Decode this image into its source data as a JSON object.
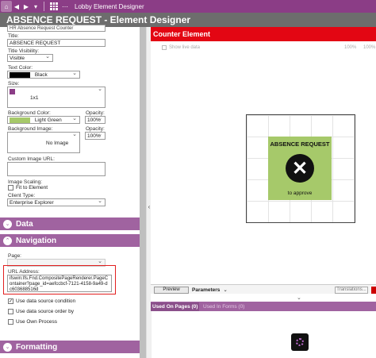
{
  "titlebar": {
    "title": "Lobby Element Designer"
  },
  "header": {
    "title": "ABSENCE REQUEST - Element Designer"
  },
  "form": {
    "top_cut_text": "HR Absence Request Counter",
    "title_label": "Title:",
    "title_value": "ABSENCE REQUEST",
    "title_visibility_label": "Title Visibility:",
    "title_visibility_value": "Visible",
    "text_color_label": "Text Color:",
    "text_color_value": "Black",
    "size_label": "Size:",
    "size_value": "1x1",
    "bg_color_label": "Background Color:",
    "bg_color_value": "Light Green",
    "opacity_label": "Opacity:",
    "opacity_value": "100%",
    "bg_image_label": "Background Image:",
    "bg_image_value": "No Image",
    "opacity2_label": "Opacity:",
    "opacity2_value": "100%",
    "custom_image_label": "Custom Image URL:",
    "custom_image_value": "",
    "image_scaling_label": "Image Scaling:",
    "fit_to_element_label": "Fit to Element",
    "client_type_label": "Client Type:",
    "client_type_value": "Enterprise Explorer"
  },
  "sections": {
    "data": "Data",
    "navigation": "Navigation",
    "formatting": "Formatting"
  },
  "navigation": {
    "page_label": "Page:",
    "page_value": "",
    "url_label": "URL Address:",
    "url_value": "ifswin:Ifs.Fnd.CompositePageRenderer.PageContainer?page_id=aefccbcf-7121-4158-9a49-dc603688516d",
    "use_ds_condition": "Use data source condition",
    "use_ds_order": "Use data source order by",
    "use_own_process": "Use Own Process"
  },
  "preview": {
    "header": "Counter Element",
    "show_live_data": "Show live data",
    "zoom_a": "100%",
    "zoom_b": "100%",
    "element_title": "ABSENCE REQUEST",
    "element_subtitle": "to approve",
    "element_icon": "x-circle-icon",
    "element_bg": "#a6c96a"
  },
  "bottom": {
    "preview_tab": "Preview",
    "parameters_tab": "Parameters",
    "translations_btn": "Translations...",
    "used_on_pages": "Used On Pages (0)",
    "used_in_forms": "Used In Forms (0)"
  },
  "colors": {
    "titlebar": "#8b3d86",
    "section": "#a063a0",
    "red_header": "#e30613",
    "highlight": "#e21f1f"
  }
}
